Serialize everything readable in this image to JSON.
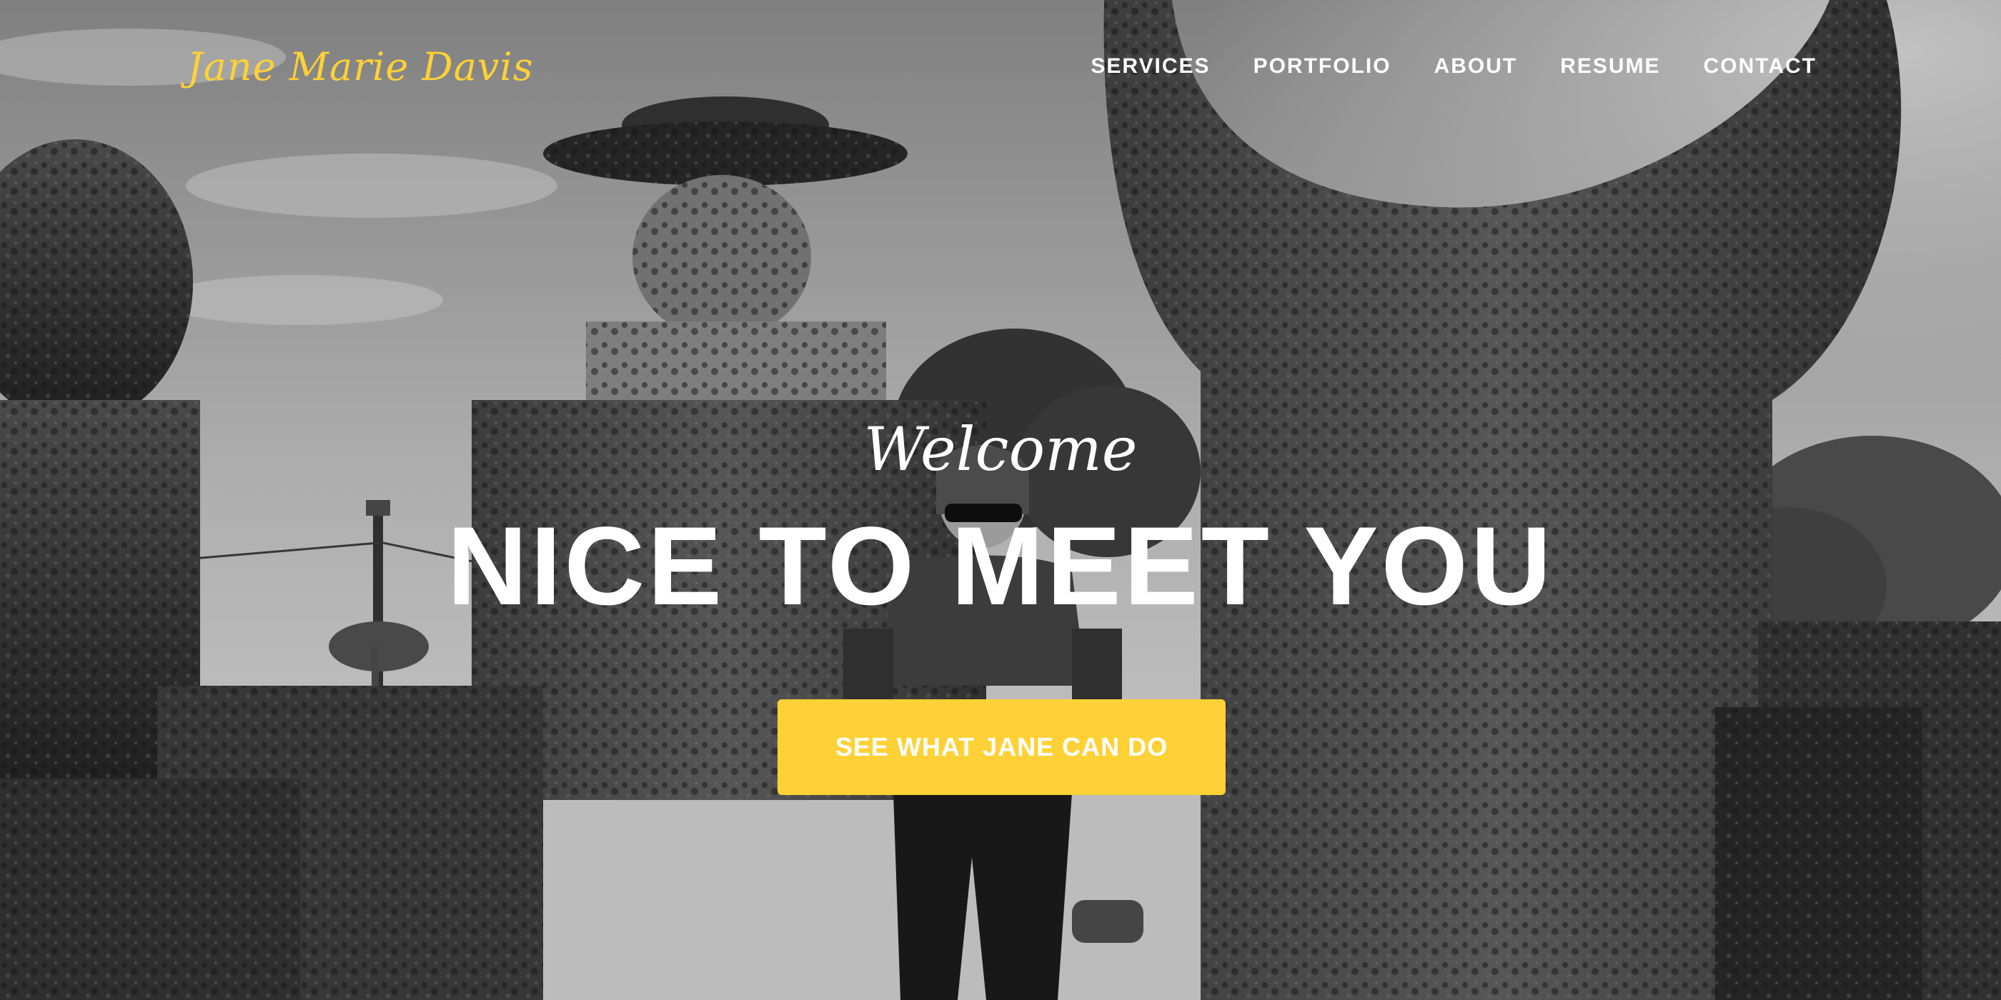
{
  "brand": {
    "name": "Jane Marie Davis",
    "color": "#fed136"
  },
  "nav": {
    "items": [
      {
        "label": "SERVICES"
      },
      {
        "label": "PORTFOLIO"
      },
      {
        "label": "ABOUT"
      },
      {
        "label": "RESUME"
      },
      {
        "label": "CONTACT"
      }
    ]
  },
  "hero": {
    "lead": "Welcome",
    "heading": "NICE TO MEET YOU",
    "cta_label": "SEE WHAT JANE CAN DO",
    "cta_color": "#fed136"
  }
}
